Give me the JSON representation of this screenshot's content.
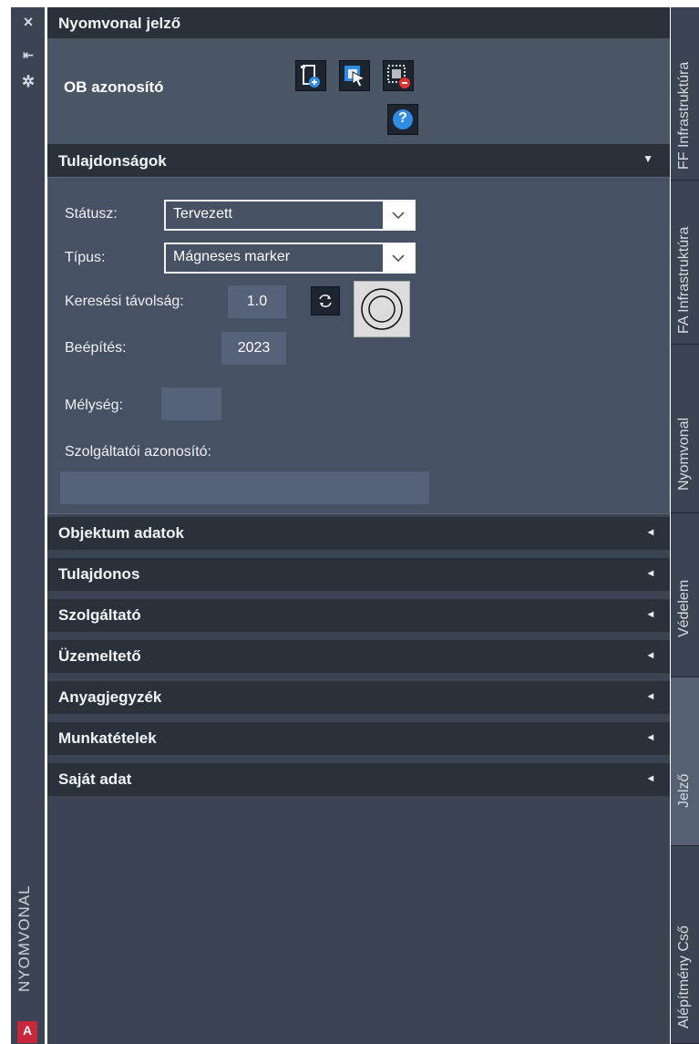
{
  "left_strip": {
    "title": "NYOMVONAL",
    "close_icon": "×",
    "pin_icon": "⇤",
    "settings_icon": "✲",
    "logo_letter": "A"
  },
  "panel": {
    "title": "Nyomvonal jelző",
    "ob_label": "OB azonosító",
    "toolbar_icons": [
      "add-object-icon",
      "select-object-icon",
      "delete-object-icon",
      "help-icon"
    ],
    "help_glyph": "?"
  },
  "properties": {
    "header": "Tulajdonságok",
    "expanded_arrow": "▼",
    "status_label": "Státusz:",
    "status_value": "Tervezett",
    "type_label": "Típus:",
    "type_value": "Mágneses marker",
    "search_distance_label": "Keresési távolság:",
    "search_distance_value": "1.0",
    "install_label": "Beépítés:",
    "install_value": "2023",
    "depth_label": "Mélység:",
    "depth_value": "",
    "provider_id_label": "Szolgáltatói azonosító:",
    "provider_id_value": ""
  },
  "sections": [
    {
      "label": "Objektum adatok"
    },
    {
      "label": "Tulajdonos"
    },
    {
      "label": "Szolgáltató"
    },
    {
      "label": "Üzemeltető"
    },
    {
      "label": "Anyagjegyzék"
    },
    {
      "label": "Munkatételek"
    },
    {
      "label": "Saját adat"
    }
  ],
  "collapsed_arrow": "◂",
  "right_tabs": [
    {
      "label": "FF Infrastruktúra",
      "active": false
    },
    {
      "label": "FA Infrastruktúra",
      "active": false
    },
    {
      "label": "Nyomvonal",
      "active": false
    },
    {
      "label": "Védelem",
      "active": false
    },
    {
      "label": "Jelző",
      "active": true
    },
    {
      "label": "Alépítmény Cső",
      "active": false
    }
  ],
  "colors": {
    "panel_bg": "#3b4453",
    "header_bg": "#2b313b",
    "ob_area_bg": "#4a5566",
    "help_blue": "#2f8de4",
    "logo_red": "#c8263a"
  }
}
